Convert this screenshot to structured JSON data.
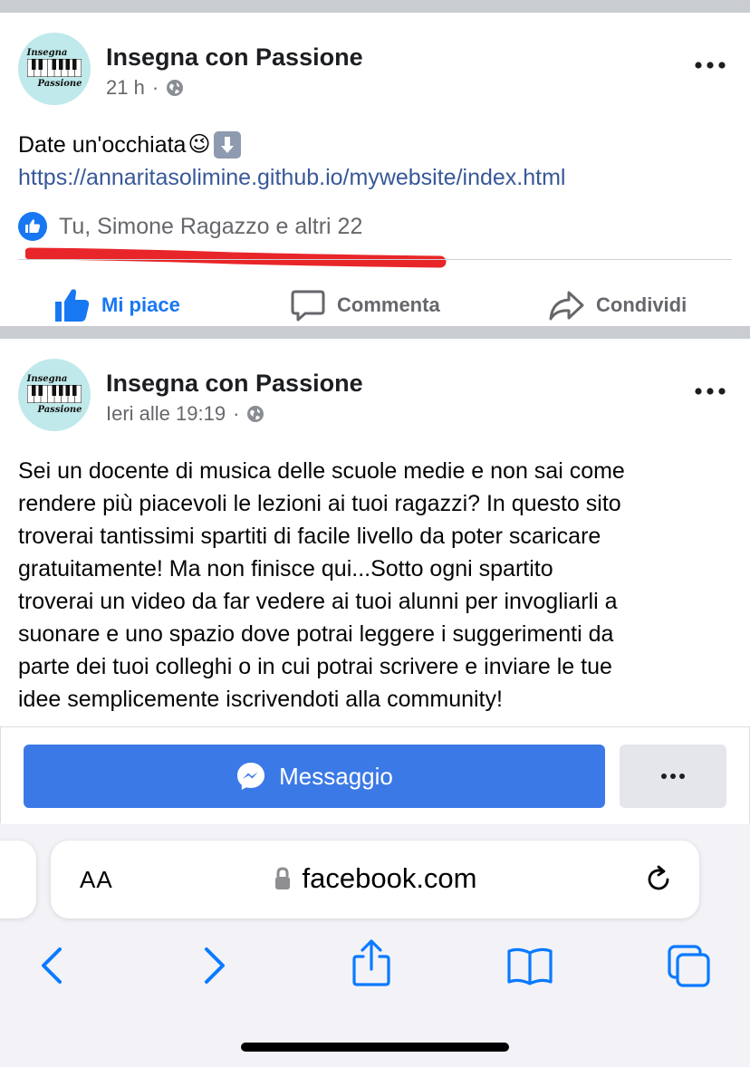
{
  "posts": [
    {
      "avatar_top": "Insegna",
      "avatar_bottom": "Passione",
      "page_name": "Insegna con Passione",
      "time": "21 h",
      "separator": "·",
      "text": "Date un'occhiata",
      "emoji_wink": "😉",
      "emoji_arrow": "⬇️",
      "link": "https://annaritasolimine.github.io/mywebsite/index.html",
      "reactions": "Tu, Simone Ragazzo e altri 22",
      "actions": {
        "like": "Mi piace",
        "comment": "Commenta",
        "share": "Condividi"
      }
    },
    {
      "avatar_top": "Insegna",
      "avatar_bottom": "Passione",
      "page_name": "Insegna con Passione",
      "time": "Ieri alle 19:19",
      "separator": "·",
      "text_lines": [
        "Sei un docente di musica delle scuole medie e non sai come",
        "rendere più piacevoli le lezioni ai tuoi ragazzi? In questo sito",
        "troverai tantissimi spartiti di facile livello da poter scaricare",
        "gratuitamente! Ma non finisce qui...Sotto ogni spartito",
        "troverai un video da far vedere ai tuoi alunni per invogliarli a",
        "suonare e uno spazio dove potrai leggere i suggerimenti da",
        "parte dei tuoi colleghi o in cui potrai scrivere e inviare le tue",
        "idee semplicemente iscrivendoti alla community!"
      ]
    }
  ],
  "message_button": {
    "label": "Messaggio"
  },
  "browser": {
    "text_size_label": "AA",
    "domain": "facebook.com"
  },
  "colors": {
    "facebook_blue": "#1877f2",
    "message_button": "#3b7ae6",
    "annotation_red": "#e8262a",
    "link": "#385898",
    "muted": "#65676b",
    "safari_blue": "#0a7aff"
  },
  "icons": [
    "globe-icon",
    "more-icon",
    "like-icon",
    "comment-icon",
    "share-icon",
    "messenger-icon",
    "lock-icon",
    "reload-icon",
    "back-icon",
    "forward-icon",
    "share-sheet-icon",
    "bookmarks-icon",
    "tabs-icon"
  ]
}
